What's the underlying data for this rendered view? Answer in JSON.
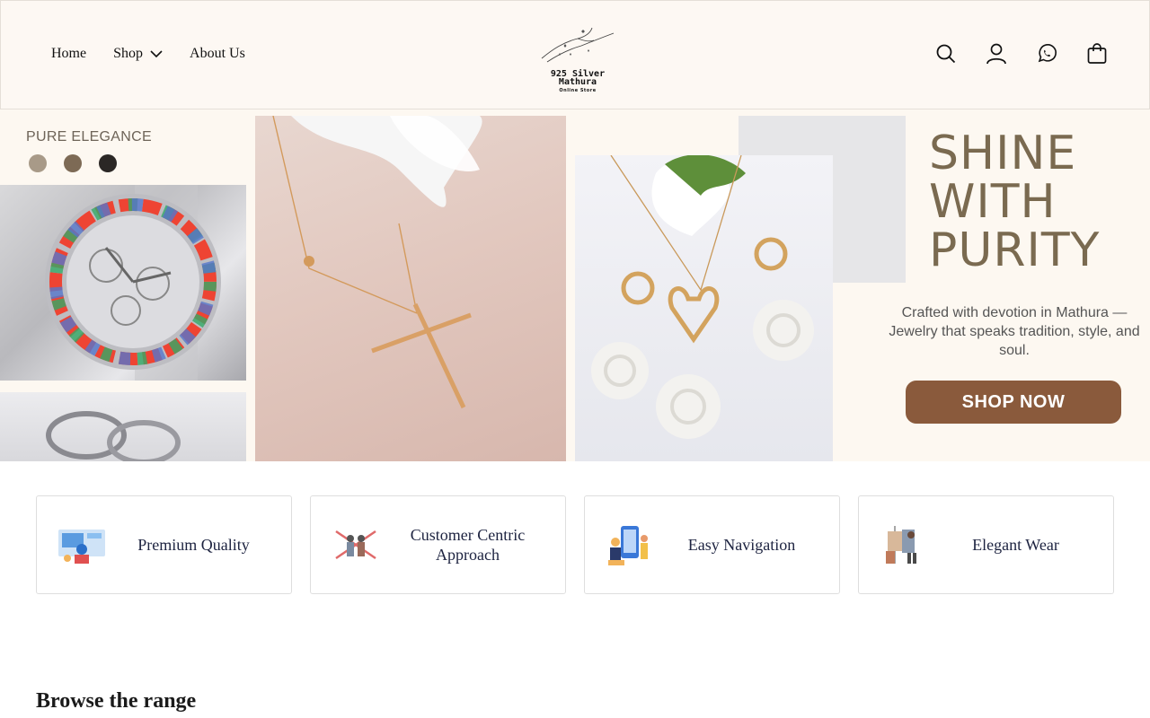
{
  "header": {
    "nav": [
      {
        "label": "Home"
      },
      {
        "label": "Shop"
      },
      {
        "label": "About Us"
      }
    ],
    "logo": {
      "line1": "925 Silver",
      "line2": "Mathura",
      "line3": "Online Store"
    },
    "icons": [
      "search-icon",
      "account-icon",
      "whatsapp-icon",
      "cart-icon"
    ]
  },
  "hero": {
    "eyebrow": "PURE ELEGANCE",
    "swatches": [
      "#a89a88",
      "#7d6a55",
      "#2b2725"
    ],
    "headline": [
      "SHINE",
      "WITH",
      "PURITY"
    ],
    "tagline": "Crafted with devotion in Mathura — Jewelry that speaks tradition, style, and soul.",
    "cta": "SHOP NOW",
    "accent": "#8a5a3c",
    "headline_color": "#7a6a50"
  },
  "features": [
    {
      "label": "Premium Quality",
      "icon": "premium-quality-icon"
    },
    {
      "label": "Customer Centric Approach",
      "icon": "customer-centric-icon"
    },
    {
      "label": "Easy Navigation",
      "icon": "easy-navigation-icon"
    },
    {
      "label": "Elegant Wear",
      "icon": "elegant-wear-icon"
    }
  ],
  "browse_title": "Browse the range"
}
